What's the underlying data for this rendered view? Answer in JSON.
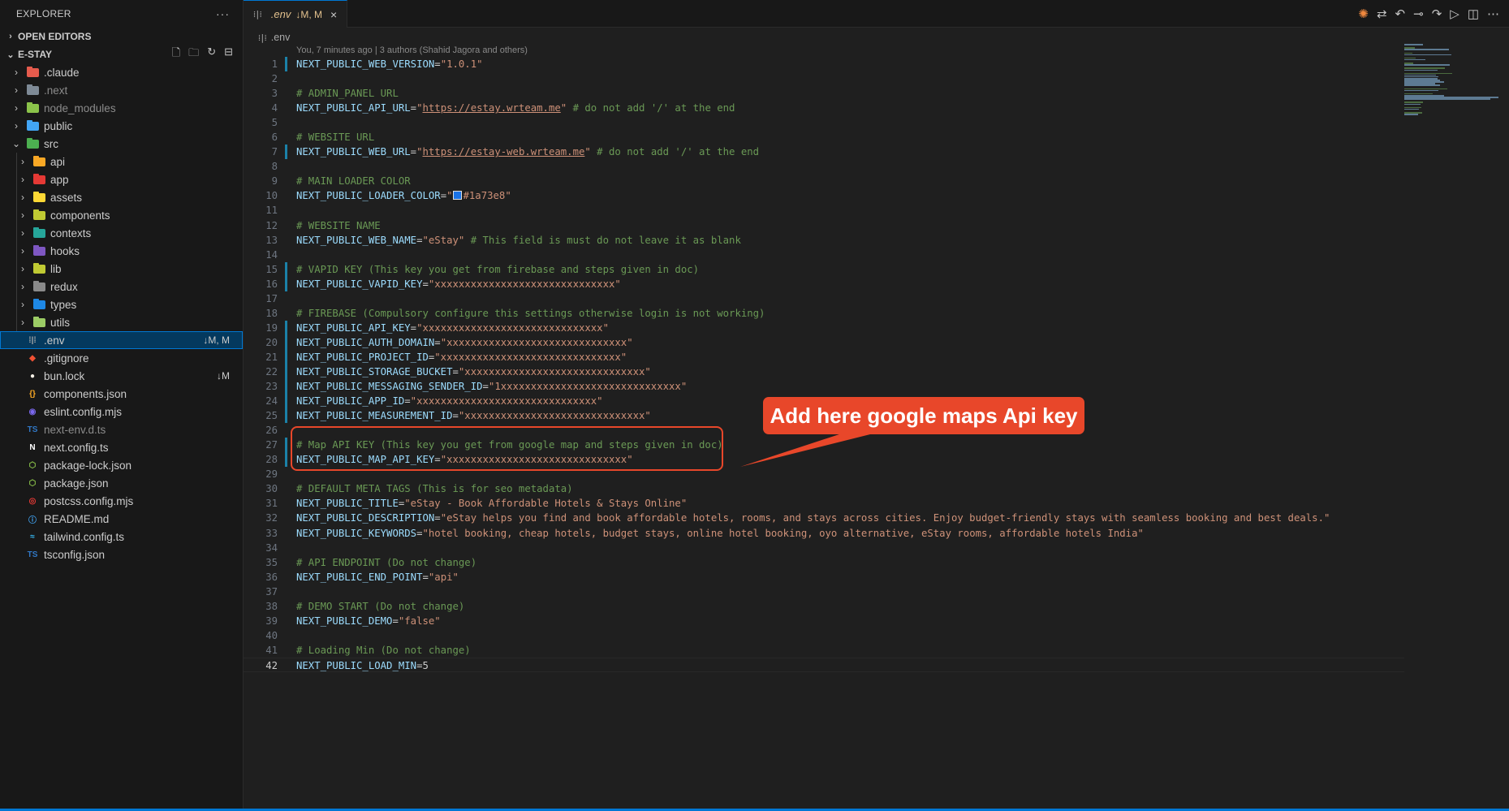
{
  "explorer": {
    "title": "EXPLORER",
    "more": "···",
    "open_editors": "OPEN EDITORS",
    "project": "E-STAY",
    "tree": [
      {
        "label": ".claude",
        "kind": "folder",
        "color": "#e55b4d",
        "depth": 0
      },
      {
        "label": ".next",
        "kind": "folder",
        "color": "#7e8a96",
        "depth": 0,
        "dim": true
      },
      {
        "label": "node_modules",
        "kind": "folder",
        "color": "#8bc34a",
        "depth": 0,
        "dim": true
      },
      {
        "label": "public",
        "kind": "folder",
        "color": "#42a5f5",
        "depth": 0
      },
      {
        "label": "src",
        "kind": "folder-open",
        "color": "#4caf50",
        "depth": 0
      },
      {
        "label": "api",
        "kind": "folder",
        "color": "#f9a825",
        "depth": 1
      },
      {
        "label": "app",
        "kind": "folder",
        "color": "#e53935",
        "depth": 1
      },
      {
        "label": "assets",
        "kind": "folder",
        "color": "#fdd835",
        "depth": 1
      },
      {
        "label": "components",
        "kind": "folder",
        "color": "#c0ca33",
        "depth": 1
      },
      {
        "label": "contexts",
        "kind": "folder",
        "color": "#26a69a",
        "depth": 1
      },
      {
        "label": "hooks",
        "kind": "folder",
        "color": "#7e57c2",
        "depth": 1
      },
      {
        "label": "lib",
        "kind": "folder",
        "color": "#c0ca33",
        "depth": 1
      },
      {
        "label": "redux",
        "kind": "folder",
        "color": "#8a8a8a",
        "depth": 1
      },
      {
        "label": "types",
        "kind": "folder",
        "color": "#1e88e5",
        "depth": 1
      },
      {
        "label": "utils",
        "kind": "folder",
        "color": "#9ccc65",
        "depth": 1
      },
      {
        "label": ".env",
        "kind": "env",
        "color": "#a9a9a9",
        "depth": 0,
        "badge": "↓M, M",
        "selected": true
      },
      {
        "label": ".gitignore",
        "kind": "git",
        "color": "#f05133",
        "depth": 0
      },
      {
        "label": "bun.lock",
        "kind": "bun",
        "color": "#f5f0e6",
        "depth": 0,
        "badge": "↓M"
      },
      {
        "label": "components.json",
        "kind": "json",
        "color": "#f9a825",
        "depth": 0
      },
      {
        "label": "eslint.config.mjs",
        "kind": "eslint",
        "color": "#7b68ee",
        "depth": 0
      },
      {
        "label": "next-env.d.ts",
        "kind": "ts",
        "color": "#3178c6",
        "depth": 0,
        "dim": true
      },
      {
        "label": "next.config.ts",
        "kind": "next",
        "color": "#ffffff",
        "depth": 0
      },
      {
        "label": "package-lock.json",
        "kind": "npm",
        "color": "#8bc34a",
        "depth": 0
      },
      {
        "label": "package.json",
        "kind": "npm",
        "color": "#8bc34a",
        "depth": 0
      },
      {
        "label": "postcss.config.mjs",
        "kind": "postcss",
        "color": "#e53935",
        "depth": 0
      },
      {
        "label": "README.md",
        "kind": "info",
        "color": "#42a5f5",
        "depth": 0
      },
      {
        "label": "tailwind.config.ts",
        "kind": "tailwind",
        "color": "#38bdf8",
        "depth": 0
      },
      {
        "label": "tsconfig.json",
        "kind": "tsconfig",
        "color": "#3178c6",
        "depth": 0
      }
    ]
  },
  "tab": {
    "name": ".env",
    "status": "↓M, M",
    "close": "×"
  },
  "breadcrumb": ".env",
  "envglyph": "⁞|⁞",
  "blame": "You, 7 minutes ago | 3 authors (Shahid Jagora and others)",
  "editor": {
    "lines": [
      {
        "n": 1,
        "mod": true,
        "parts": [
          [
            "k",
            "NEXT_PUBLIC_WEB_VERSION"
          ],
          [
            "p",
            "="
          ],
          [
            "s",
            "\"1.0.1\""
          ]
        ]
      },
      {
        "n": 2,
        "parts": []
      },
      {
        "n": 3,
        "parts": [
          [
            "c",
            "# ADMIN_PANEL URL"
          ]
        ]
      },
      {
        "n": 4,
        "parts": [
          [
            "k",
            "NEXT_PUBLIC_API_URL"
          ],
          [
            "p",
            "="
          ],
          [
            "s",
            "\""
          ],
          [
            "u",
            "https://estay.wrteam.me"
          ],
          [
            "s",
            "\""
          ],
          [
            "c",
            " # do not add '/' at the end"
          ]
        ]
      },
      {
        "n": 5,
        "parts": []
      },
      {
        "n": 6,
        "parts": [
          [
            "c",
            "# WEBSITE URL"
          ]
        ]
      },
      {
        "n": 7,
        "mod": true,
        "parts": [
          [
            "k",
            "NEXT_PUBLIC_WEB_URL"
          ],
          [
            "p",
            "="
          ],
          [
            "s",
            "\""
          ],
          [
            "u",
            "https://estay-web.wrteam.me"
          ],
          [
            "s",
            "\""
          ],
          [
            "c",
            " # do not add '/' at the end"
          ]
        ]
      },
      {
        "n": 8,
        "parts": []
      },
      {
        "n": 9,
        "parts": [
          [
            "c",
            "# MAIN LOADER COLOR"
          ]
        ]
      },
      {
        "n": 10,
        "parts": [
          [
            "k",
            "NEXT_PUBLIC_LOADER_COLOR"
          ],
          [
            "p",
            "="
          ],
          [
            "s",
            "\""
          ],
          [
            "sw",
            ""
          ],
          [
            "s",
            "#1a73e8\""
          ]
        ]
      },
      {
        "n": 11,
        "parts": []
      },
      {
        "n": 12,
        "parts": [
          [
            "c",
            "# WEBSITE NAME"
          ]
        ]
      },
      {
        "n": 13,
        "parts": [
          [
            "k",
            "NEXT_PUBLIC_WEB_NAME"
          ],
          [
            "p",
            "="
          ],
          [
            "s",
            "\"eStay\""
          ],
          [
            "c",
            " # This field is must do not leave it as blank"
          ]
        ]
      },
      {
        "n": 14,
        "parts": []
      },
      {
        "n": 15,
        "mod": true,
        "parts": [
          [
            "c",
            "# VAPID KEY (This key you get from firebase and steps given in doc)"
          ]
        ]
      },
      {
        "n": 16,
        "mod": true,
        "parts": [
          [
            "k",
            "NEXT_PUBLIC_VAPID_KEY"
          ],
          [
            "p",
            "="
          ],
          [
            "s",
            "\"xxxxxxxxxxxxxxxxxxxxxxxxxxxxxx\""
          ]
        ]
      },
      {
        "n": 17,
        "parts": []
      },
      {
        "n": 18,
        "parts": [
          [
            "c",
            "# FIREBASE (Compulsory configure this settings otherwise login is not working)"
          ]
        ]
      },
      {
        "n": 19,
        "mod": true,
        "parts": [
          [
            "k",
            "NEXT_PUBLIC_API_KEY"
          ],
          [
            "p",
            "="
          ],
          [
            "s",
            "\"xxxxxxxxxxxxxxxxxxxxxxxxxxxxxx\""
          ]
        ]
      },
      {
        "n": 20,
        "mod": true,
        "parts": [
          [
            "k",
            "NEXT_PUBLIC_AUTH_DOMAIN"
          ],
          [
            "p",
            "="
          ],
          [
            "s",
            "\"xxxxxxxxxxxxxxxxxxxxxxxxxxxxxx\""
          ]
        ]
      },
      {
        "n": 21,
        "mod": true,
        "parts": [
          [
            "k",
            "NEXT_PUBLIC_PROJECT_ID"
          ],
          [
            "p",
            "="
          ],
          [
            "s",
            "\"xxxxxxxxxxxxxxxxxxxxxxxxxxxxxx\""
          ]
        ]
      },
      {
        "n": 22,
        "mod": true,
        "parts": [
          [
            "k",
            "NEXT_PUBLIC_STORAGE_BUCKET"
          ],
          [
            "p",
            "="
          ],
          [
            "s",
            "\"xxxxxxxxxxxxxxxxxxxxxxxxxxxxxx\""
          ]
        ]
      },
      {
        "n": 23,
        "mod": true,
        "parts": [
          [
            "k",
            "NEXT_PUBLIC_MESSAGING_SENDER_ID"
          ],
          [
            "p",
            "="
          ],
          [
            "s",
            "\"1xxxxxxxxxxxxxxxxxxxxxxxxxxxxxx\""
          ]
        ]
      },
      {
        "n": 24,
        "mod": true,
        "parts": [
          [
            "k",
            "NEXT_PUBLIC_APP_ID"
          ],
          [
            "p",
            "="
          ],
          [
            "s",
            "\"xxxxxxxxxxxxxxxxxxxxxxxxxxxxxx\""
          ]
        ]
      },
      {
        "n": 25,
        "mod": true,
        "parts": [
          [
            "k",
            "NEXT_PUBLIC_MEASUREMENT_ID"
          ],
          [
            "p",
            "="
          ],
          [
            "s",
            "\"xxxxxxxxxxxxxxxxxxxxxxxxxxxxxx\""
          ]
        ]
      },
      {
        "n": 26,
        "parts": []
      },
      {
        "n": 27,
        "mod": true,
        "parts": [
          [
            "c",
            "# Map API KEY (This key you get from google map and steps given in doc)"
          ]
        ]
      },
      {
        "n": 28,
        "mod": true,
        "parts": [
          [
            "k",
            "NEXT_PUBLIC_MAP_API_KEY"
          ],
          [
            "p",
            "="
          ],
          [
            "s",
            "\"xxxxxxxxxxxxxxxxxxxxxxxxxxxxxx\""
          ]
        ]
      },
      {
        "n": 29,
        "parts": []
      },
      {
        "n": 30,
        "parts": [
          [
            "c",
            "# DEFAULT META TAGS (This is for seo metadata)"
          ]
        ]
      },
      {
        "n": 31,
        "parts": [
          [
            "k",
            "NEXT_PUBLIC_TITLE"
          ],
          [
            "p",
            "="
          ],
          [
            "s",
            "\"eStay - Book Affordable Hotels & Stays Online\""
          ]
        ]
      },
      {
        "n": 32,
        "parts": [
          [
            "k",
            "NEXT_PUBLIC_DESCRIPTION"
          ],
          [
            "p",
            "="
          ],
          [
            "s",
            "\"eStay helps you find and book affordable hotels, rooms, and stays across cities. Enjoy budget-friendly stays with seamless booking and best deals.\""
          ]
        ]
      },
      {
        "n": 33,
        "parts": [
          [
            "k",
            "NEXT_PUBLIC_KEYWORDS"
          ],
          [
            "p",
            "="
          ],
          [
            "s",
            "\"hotel booking, cheap hotels, budget stays, online hotel booking, oyo alternative, eStay rooms, affordable hotels India\""
          ]
        ]
      },
      {
        "n": 34,
        "parts": []
      },
      {
        "n": 35,
        "parts": [
          [
            "c",
            "# API ENDPOINT (Do not change)"
          ]
        ]
      },
      {
        "n": 36,
        "parts": [
          [
            "k",
            "NEXT_PUBLIC_END_POINT"
          ],
          [
            "p",
            "="
          ],
          [
            "s",
            "\"api\""
          ]
        ]
      },
      {
        "n": 37,
        "parts": []
      },
      {
        "n": 38,
        "parts": [
          [
            "c",
            "# DEMO START (Do not change)"
          ]
        ]
      },
      {
        "n": 39,
        "parts": [
          [
            "k",
            "NEXT_PUBLIC_DEMO"
          ],
          [
            "p",
            "="
          ],
          [
            "s",
            "\"false\""
          ]
        ]
      },
      {
        "n": 40,
        "parts": []
      },
      {
        "n": 41,
        "parts": [
          [
            "c",
            "# Loading Min (Do not change)"
          ]
        ]
      },
      {
        "n": 42,
        "cur": true,
        "parts": [
          [
            "k",
            "NEXT_PUBLIC_LOAD_MIN"
          ],
          [
            "p",
            "="
          ],
          [
            "p",
            "5"
          ]
        ]
      }
    ]
  },
  "annotation": {
    "text": "Add here google maps Api key",
    "color": "#e8472a"
  },
  "colors": {
    "accent": "#0078d4",
    "sidebar_bg": "#181818",
    "editor_bg": "#1f1f1f"
  }
}
